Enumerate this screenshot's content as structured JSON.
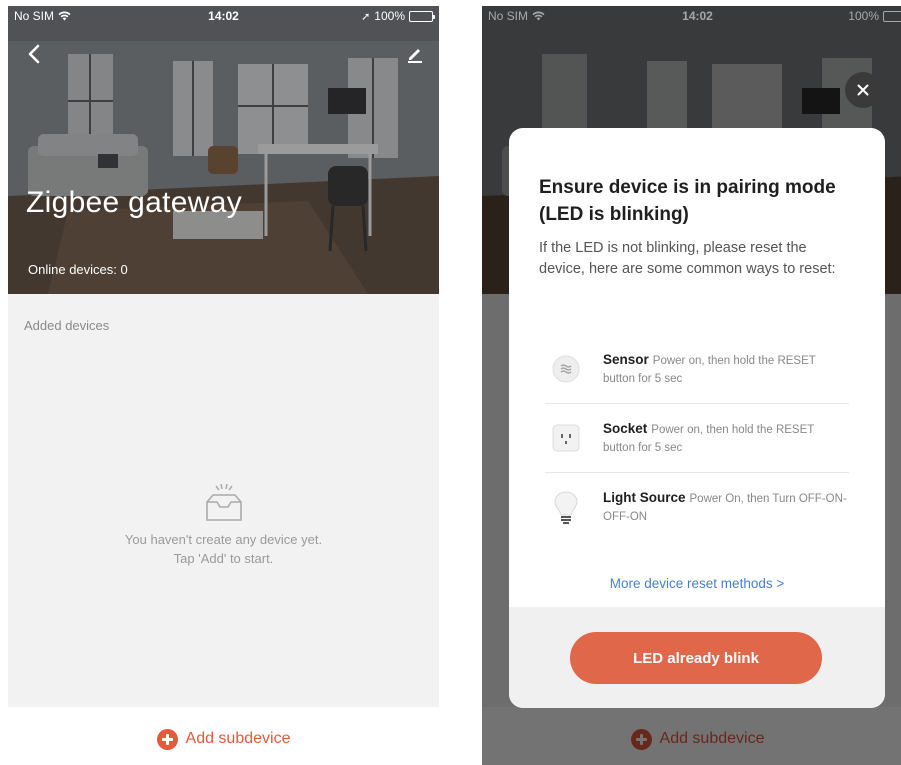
{
  "status_bar": {
    "carrier": "No SIM",
    "time": "14:02",
    "battery": "100%"
  },
  "left_screen": {
    "title": "Zigbee gateway",
    "online_devices": "Online devices: 0",
    "section_label": "Added devices",
    "empty_line1": "You haven't create any device yet.",
    "empty_line2": "Tap 'Add' to start.",
    "add_label": "Add subdevice"
  },
  "modal": {
    "title": "Ensure device is in pairing mode (LED is blinking)",
    "description": "If the LED is not blinking, please reset the device, here are some common ways to reset:",
    "items": [
      {
        "name": "Sensor",
        "instruction": "Power on, then hold the RESET button for 5 sec",
        "icon": "sensor-icon"
      },
      {
        "name": "Socket",
        "instruction": "Power on, then hold the RESET button for 5 sec",
        "icon": "socket-icon"
      },
      {
        "name": "Light Source",
        "instruction": "Power On, then Turn OFF-ON-OFF-ON",
        "icon": "bulb-icon"
      }
    ],
    "more_link": "More device reset methods >",
    "confirm_button": "LED already blink"
  },
  "colors": {
    "accent": "#e5593c",
    "link": "#4a7ed4",
    "button": "#e0674a"
  }
}
